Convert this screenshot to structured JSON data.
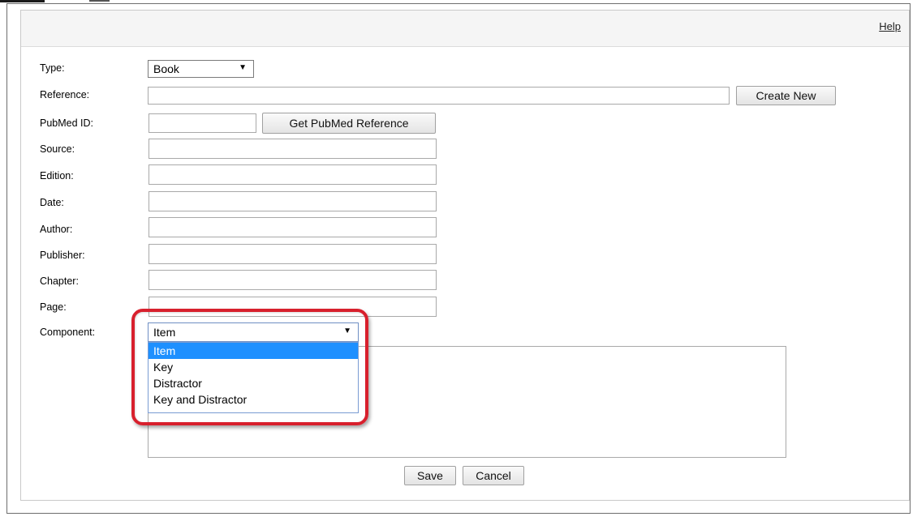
{
  "header": {
    "help_label": "Help"
  },
  "form": {
    "type": {
      "label": "Type:",
      "value": "Book"
    },
    "reference": {
      "label": "Reference:",
      "value": "",
      "create_new_label": "Create New"
    },
    "pubmed": {
      "label": "PubMed ID:",
      "value": "",
      "get_label": "Get PubMed Reference"
    },
    "source": {
      "label": "Source:",
      "value": ""
    },
    "edition": {
      "label": "Edition:",
      "value": ""
    },
    "date": {
      "label": "Date:",
      "value": ""
    },
    "author": {
      "label": "Author:",
      "value": ""
    },
    "publisher": {
      "label": "Publisher:",
      "value": ""
    },
    "chapter": {
      "label": "Chapter:",
      "value": ""
    },
    "page": {
      "label": "Page:",
      "value": ""
    },
    "component": {
      "label": "Component:",
      "value": "Item",
      "options": [
        "Item",
        "Key",
        "Distractor",
        "Key and Distractor"
      ],
      "selected_index": 0
    }
  },
  "actions": {
    "save_label": "Save",
    "cancel_label": "Cancel"
  },
  "colors": {
    "highlight": "#d8202d",
    "selected_option": "#1e90ff"
  },
  "icons": {
    "dropdown_arrow": "triangle-down-icon"
  }
}
